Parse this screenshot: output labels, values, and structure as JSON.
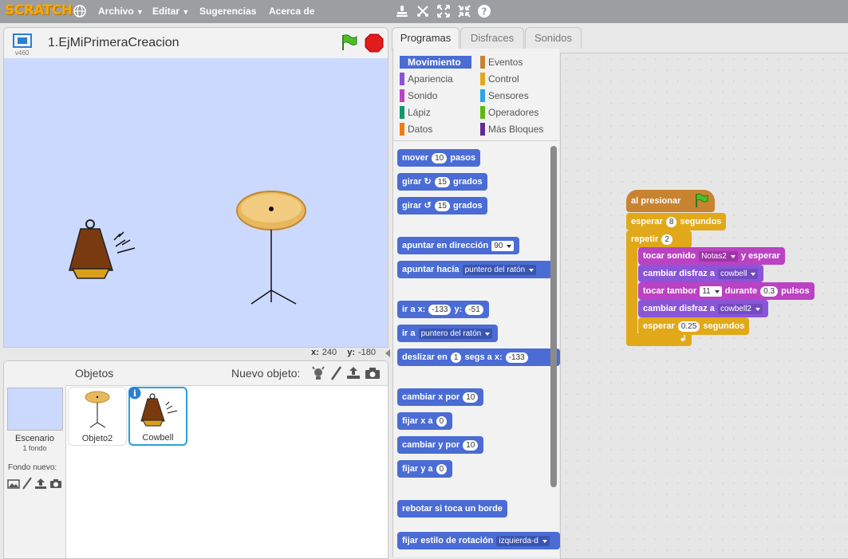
{
  "app": {
    "logo": "SCRATCH"
  },
  "menu": {
    "archivo": "Archivo",
    "editar": "Editar",
    "sugerencias": "Sugerencias",
    "acerca": "Acerca de"
  },
  "stage": {
    "title": "1.EjMiPrimeraCreacion",
    "version": "v460",
    "x_label": "x:",
    "x_value": "240",
    "y_label": "y:",
    "y_value": "-180"
  },
  "sprites": {
    "objects_label": "Objetos",
    "new_object_label": "Nuevo objeto:",
    "scene_label": "Escenario",
    "scene_sub": "1 fondo",
    "new_backdrop_label": "Fondo nuevo:",
    "items": [
      {
        "label": "Objeto2"
      },
      {
        "label": "Cowbell"
      }
    ]
  },
  "tabs": [
    "Programas",
    "Disfraces",
    "Sonidos"
  ],
  "categories": {
    "left": [
      "Movimiento",
      "Apariencia",
      "Sonido",
      "Lápiz",
      "Datos"
    ],
    "right": [
      "Eventos",
      "Control",
      "Sensores",
      "Operadores",
      "Más Bloques"
    ],
    "left_colors": [
      "#4a6cd4",
      "#8a55d7",
      "#bb42c3",
      "#0e9a6c",
      "#ee7d16"
    ],
    "right_colors": [
      "#c88330",
      "#e1a91a",
      "#2ca5e2",
      "#5cb712",
      "#632d99"
    ]
  },
  "palette": {
    "move": {
      "pre": "mover",
      "arg": "10",
      "post": "pasos"
    },
    "turn_right": {
      "pre": "girar",
      "arg": "15",
      "post": "grados"
    },
    "turn_left": {
      "pre": "girar",
      "arg": "15",
      "post": "grados"
    },
    "point_dir": {
      "pre": "apuntar en dirección",
      "arg": "90"
    },
    "point_towards": {
      "pre": "apuntar hacia",
      "arg": "puntero del ratón"
    },
    "goto_xy": {
      "pre": "ir a x:",
      "x": "-133",
      "mid": "y:",
      "y": "-51"
    },
    "goto": {
      "pre": "ir a",
      "arg": "puntero del ratón"
    },
    "glide": {
      "pre": "deslizar en",
      "secs": "1",
      "mid": "segs a x:",
      "x": "-133"
    },
    "change_x": {
      "pre": "cambiar x por",
      "arg": "10"
    },
    "set_x": {
      "pre": "fijar x a",
      "arg": "0"
    },
    "change_y": {
      "pre": "cambiar y por",
      "arg": "10"
    },
    "set_y": {
      "pre": "fijar y a",
      "arg": "0"
    },
    "bounce": {
      "label": "rebotar si toca un borde"
    },
    "rotation_style": {
      "pre": "fijar estilo de rotación",
      "arg": "izquierda-d"
    }
  },
  "script": {
    "hat": "al presionar",
    "wait1": {
      "pre": "esperar",
      "arg": "8",
      "post": "segundos"
    },
    "repeat": {
      "pre": "repetir",
      "arg": "2"
    },
    "play_sound": {
      "pre": "tocar sonido",
      "arg": "Notas2",
      "post": "y esperar"
    },
    "costume1": {
      "pre": "cambiar disfraz a",
      "arg": "cowbell"
    },
    "drum": {
      "pre": "tocar tambor",
      "arg": "11",
      "mid": "durante",
      "beats": "0.3",
      "post": "pulsos"
    },
    "costume2": {
      "pre": "cambiar disfraz a",
      "arg": "cowbell2"
    },
    "wait2": {
      "pre": "esperar",
      "arg": "0.25",
      "post": "segundos"
    }
  }
}
